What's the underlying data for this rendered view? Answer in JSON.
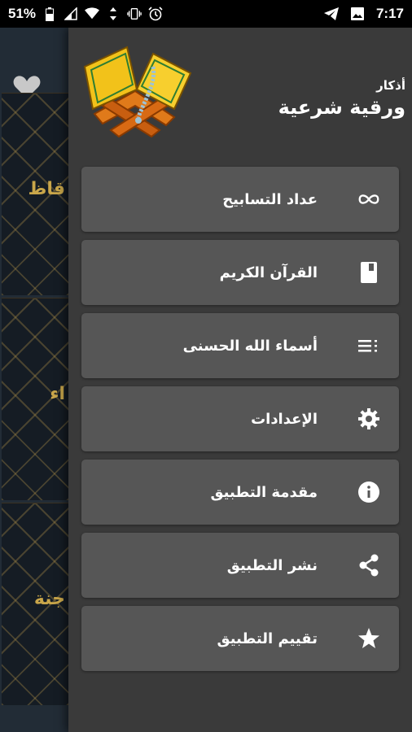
{
  "status_bar": {
    "battery": "51%",
    "time": "7:17",
    "left_icons": [
      "battery-icon",
      "signal-icon",
      "wifi-icon",
      "data-arrows-icon",
      "vibrate-icon",
      "alarm-icon"
    ],
    "right_icons": [
      "telegram-icon",
      "gallery-icon"
    ]
  },
  "background_app": {
    "cards": [
      "قاظ",
      "اء",
      "جنة"
    ],
    "heart_icon": "heart-icon"
  },
  "drawer": {
    "header": {
      "title_small": "أذكار",
      "title_big": "ورقية شرعية",
      "logo_icon": "quran-book-icon"
    },
    "items": [
      {
        "label": "عداد التسابيح",
        "icon": "infinity-icon"
      },
      {
        "label": "القرآن الكريم",
        "icon": "book-icon"
      },
      {
        "label": "أسماء الله الحسنى",
        "icon": "list-icon"
      },
      {
        "label": "الإعدادات",
        "icon": "gear-icon"
      },
      {
        "label": "مقدمة التطبيق",
        "icon": "info-icon"
      },
      {
        "label": "نشر التطبيق",
        "icon": "share-icon"
      },
      {
        "label": "تقييم التطبيق",
        "icon": "star-icon"
      }
    ]
  },
  "colors": {
    "drawer_bg": "#3a3a3a",
    "menu_item_bg": "#565656",
    "status_bar_bg": "#000000",
    "gold_text": "#c9a64a"
  }
}
